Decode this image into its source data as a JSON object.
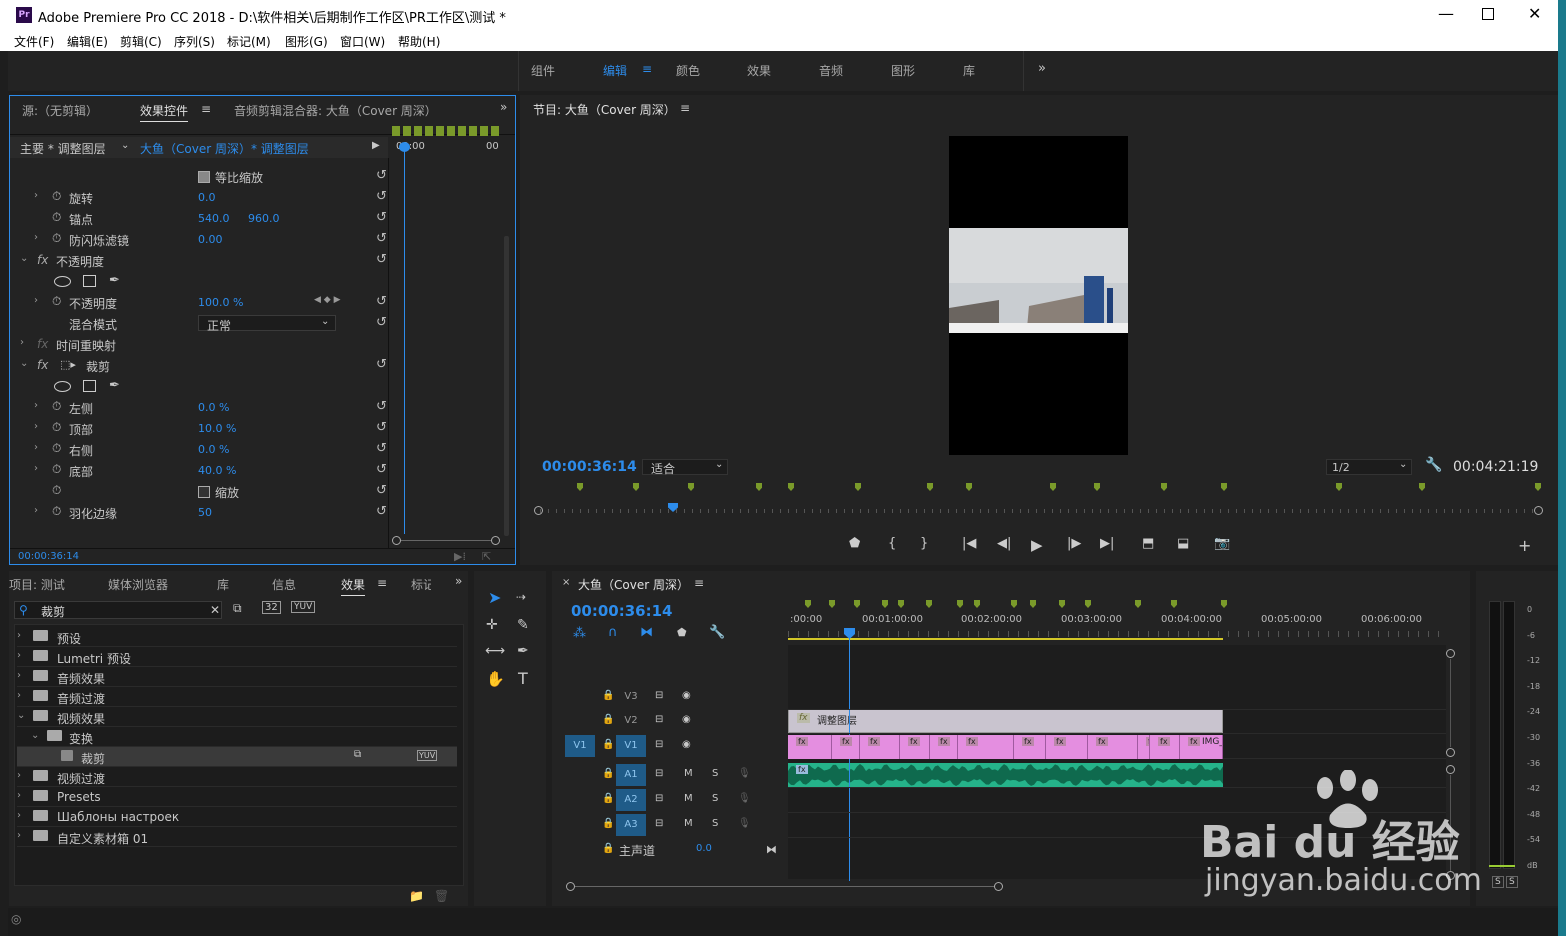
{
  "titlebar": {
    "title": "Adobe Premiere Pro CC 2018 - D:\\软件相关\\后期制作工作区\\PR工作区\\测试 *",
    "app_icon": "Pr"
  },
  "menu": [
    "文件(F)",
    "编辑(E)",
    "剪辑(C)",
    "序列(S)",
    "标记(M)",
    "图形(G)",
    "窗口(W)",
    "帮助(H)"
  ],
  "workspaces": [
    "组件",
    "编辑",
    "颜色",
    "效果",
    "音频",
    "图形",
    "库"
  ],
  "source_panel": {
    "tabs": [
      "源:（无剪辑）",
      "效果控件",
      "音频剪辑混合器: 大鱼（Cover 周深）"
    ],
    "master": "主要 * 调整图层",
    "clip": "大鱼（Cover 周深）* 调整图层",
    "timecode_small": "00:00",
    "timecode_end": "00",
    "bottom_tc": "00:00:36:14"
  },
  "effect_rows": {
    "uniform": "等比缩放",
    "rotation": "旋转",
    "rotation_val": "0.0",
    "anchor": "锚点",
    "anchor_x": "540.0",
    "anchor_y": "960.0",
    "flicker": "防闪烁滤镜",
    "flicker_val": "0.00",
    "opacity_group": "不透明度",
    "opacity": "不透明度",
    "opacity_val": "100.0 %",
    "blend": "混合模式",
    "blend_val": "正常",
    "timeremap": "时间重映射",
    "crop": "裁剪",
    "left": "左侧",
    "left_val": "0.0 %",
    "top": "顶部",
    "top_val": "10.0 %",
    "right": "右侧",
    "right_val": "0.0 %",
    "bottom": "底部",
    "bottom_val": "40.0 %",
    "zoom": "缩放",
    "feather": "羽化边缘",
    "feather_val": "50",
    "fx": "fx"
  },
  "program": {
    "title": "节目: 大鱼（Cover 周深）",
    "tc": "00:00:36:14",
    "fit": "适合",
    "res": "1/2",
    "duration": "00:04:21:19"
  },
  "project_panel": {
    "tabs": [
      "项目: 测试",
      "媒体浏览器",
      "库",
      "信息",
      "效果",
      "标记"
    ],
    "search": "裁剪",
    "items": [
      "预设",
      "Lumetri 预设",
      "音频效果",
      "音频过渡",
      "视频效果",
      "变换",
      "裁剪",
      "视频过渡",
      "Presets",
      "Шаблоны настроек",
      "自定义素材箱 01"
    ]
  },
  "timeline": {
    "title": "大鱼（Cover 周深）",
    "tc": "00:00:36:14",
    "ruler": [
      ":00:00",
      "00:01:00:00",
      "00:02:00:00",
      "00:03:00:00",
      "00:04:00:00",
      "00:05:00:00",
      "00:06:00:00"
    ],
    "tracks": [
      "V3",
      "V2",
      "V1",
      "A1",
      "A2",
      "A3"
    ],
    "master": "主声道",
    "master_val": "0.0",
    "adj_clip": "调整图层",
    "img": "IMG_",
    "img2": "IMG_",
    "m": "M",
    "s": "S",
    "v1_src": "V1"
  },
  "meter": {
    "labels": [
      "0",
      "-6",
      "-12",
      "-18",
      "-24",
      "-30",
      "-36",
      "-42",
      "-48",
      "-54",
      "dB"
    ],
    "solo": "S"
  },
  "watermark": {
    "text": "Bai du 经验",
    "url": "jingyan.baidu.com"
  },
  "colors": {
    "accent": "#2d8ceb",
    "clip_video": "#e48ee0",
    "clip_audio": "#25b38a",
    "adj": "#c9c4cf",
    "marker": "#7a9a2a"
  }
}
